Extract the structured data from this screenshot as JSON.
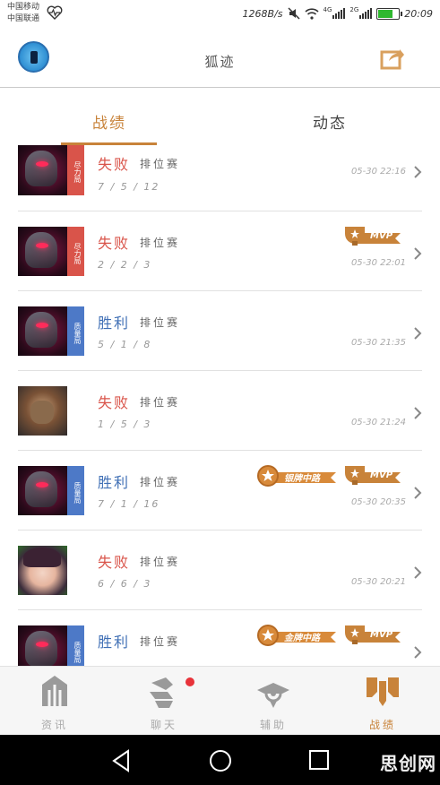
{
  "status_bar": {
    "carrier_1": "中国移动",
    "carrier_2": "中国联通",
    "speed": "1268B/s",
    "net_4g": "4G",
    "net_2g": "2G",
    "time": "20:09",
    "battery_level": 0.7,
    "battery_color": "#2fb82f"
  },
  "header": {
    "title": "狐迹",
    "avatar_icon": "user-avatar",
    "share_icon": "share-icon"
  },
  "tabs": [
    {
      "label": "战绩",
      "active": true
    },
    {
      "label": "动态",
      "active": false
    }
  ],
  "colors": {
    "accent": "#c8833a",
    "lose": "#d9544a",
    "win": "#3f6fb5",
    "tag_red": "#d9544a",
    "tag_blue": "#4d79c7"
  },
  "matches": [
    {
      "hero": "dark-knight",
      "tag": "尽力局",
      "tag_color": "red",
      "result": "失败",
      "outcome": "lose",
      "mode": "排位赛",
      "kda": "7 / 5 / 12",
      "time": "05-30 22:16",
      "badges": []
    },
    {
      "hero": "dark-knight",
      "tag": "尽力局",
      "tag_color": "red",
      "result": "失败",
      "outcome": "lose",
      "mode": "排位赛",
      "kda": "2 / 2 / 3",
      "time": "05-30 22:01",
      "badges": [
        {
          "type": "mvp",
          "label": "MVP"
        }
      ]
    },
    {
      "hero": "dark-knight",
      "tag": "质量局",
      "tag_color": "blue",
      "result": "胜利",
      "outcome": "win",
      "mode": "排位赛",
      "kda": "5 / 1 / 8",
      "time": "05-30 21:35",
      "badges": []
    },
    {
      "hero": "beast",
      "tag": "",
      "tag_color": "",
      "result": "失败",
      "outcome": "lose",
      "mode": "排位赛",
      "kda": "1 / 5 / 3",
      "time": "05-30 21:24",
      "badges": []
    },
    {
      "hero": "dark-knight",
      "tag": "质量局",
      "tag_color": "blue",
      "result": "胜利",
      "outcome": "win",
      "mode": "排位赛",
      "kda": "7 / 1 / 16",
      "time": "05-30 20:35",
      "badges": [
        {
          "type": "role",
          "label": "银牌中路"
        },
        {
          "type": "mvp",
          "label": "MVP"
        }
      ]
    },
    {
      "hero": "girl",
      "tag": "",
      "tag_color": "",
      "result": "失败",
      "outcome": "lose",
      "mode": "排位赛",
      "kda": "6 / 6 / 3",
      "time": "05-30 20:21",
      "badges": []
    },
    {
      "hero": "dark-knight",
      "tag": "质量局",
      "tag_color": "blue",
      "result": "胜利",
      "outcome": "win",
      "mode": "排位赛",
      "kda": "",
      "time": "",
      "badges": [
        {
          "type": "role",
          "label": "金牌中路"
        },
        {
          "type": "mvp",
          "label": "MVP"
        }
      ]
    }
  ],
  "bottom_nav": [
    {
      "label": "资讯",
      "icon": "news-icon",
      "active": false,
      "dot": false
    },
    {
      "label": "聊天",
      "icon": "chat-icon",
      "active": false,
      "dot": true
    },
    {
      "label": "辅助",
      "icon": "assist-icon",
      "active": false,
      "dot": false
    },
    {
      "label": "战绩",
      "icon": "record-icon",
      "active": true,
      "dot": false
    }
  ],
  "android_nav": {
    "back_icon": "back-triangle-icon",
    "home_icon": "home-circle-icon",
    "recents_icon": "recents-square-icon"
  },
  "watermark": "思创网"
}
